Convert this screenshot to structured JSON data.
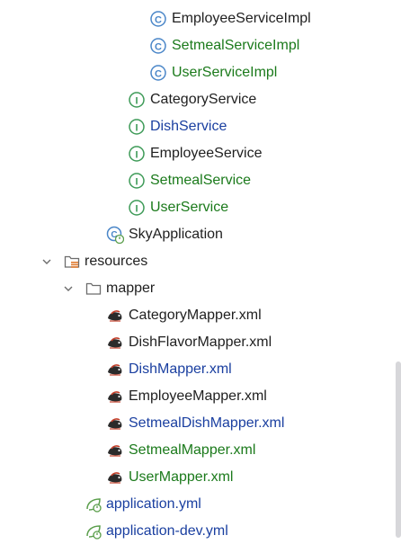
{
  "colors": {
    "default_text": "#1f1f1f",
    "modified_blue": "#1a3fa0",
    "added_green": "#1b7a1b",
    "class_icon": "#4a86c8",
    "interface_icon": "#3d9a57",
    "xml_icon": "#c4412c",
    "yml_icon": "#5a9e4b"
  },
  "tree": {
    "service_impl_items": [
      {
        "label": "EmployeeServiceImpl",
        "icon": "class-icon",
        "status": "default"
      },
      {
        "label": "SetmealServiceImpl",
        "icon": "class-icon",
        "status": "added"
      },
      {
        "label": "UserServiceImpl",
        "icon": "class-icon",
        "status": "added"
      }
    ],
    "service_items": [
      {
        "label": "CategoryService",
        "icon": "interface-icon",
        "status": "default"
      },
      {
        "label": "DishService",
        "icon": "interface-icon",
        "status": "modified"
      },
      {
        "label": "EmployeeService",
        "icon": "interface-icon",
        "status": "default"
      },
      {
        "label": "SetmealService",
        "icon": "interface-icon",
        "status": "added"
      },
      {
        "label": "UserService",
        "icon": "interface-icon",
        "status": "added"
      }
    ],
    "app_class": {
      "label": "SkyApplication",
      "icon": "spring-boot-class-icon"
    },
    "resources_folder": {
      "label": "resources",
      "icon": "resources-folder-icon",
      "expanded": true
    },
    "mapper_folder": {
      "label": "mapper",
      "icon": "folder-icon",
      "expanded": true
    },
    "mapper_files": [
      {
        "label": "CategoryMapper.xml",
        "icon": "mybatis-xml-icon",
        "status": "default"
      },
      {
        "label": "DishFlavorMapper.xml",
        "icon": "mybatis-xml-icon",
        "status": "default"
      },
      {
        "label": "DishMapper.xml",
        "icon": "mybatis-xml-icon",
        "status": "modified"
      },
      {
        "label": "EmployeeMapper.xml",
        "icon": "mybatis-xml-icon",
        "status": "default"
      },
      {
        "label": "SetmealDishMapper.xml",
        "icon": "mybatis-xml-icon",
        "status": "modified"
      },
      {
        "label": "SetmealMapper.xml",
        "icon": "mybatis-xml-icon",
        "status": "added"
      },
      {
        "label": "UserMapper.xml",
        "icon": "mybatis-xml-icon",
        "status": "added"
      }
    ],
    "config_files": [
      {
        "label": "application.yml",
        "icon": "spring-yml-icon",
        "status": "modified"
      },
      {
        "label": "application-dev.yml",
        "icon": "spring-yml-icon",
        "status": "modified"
      }
    ]
  }
}
